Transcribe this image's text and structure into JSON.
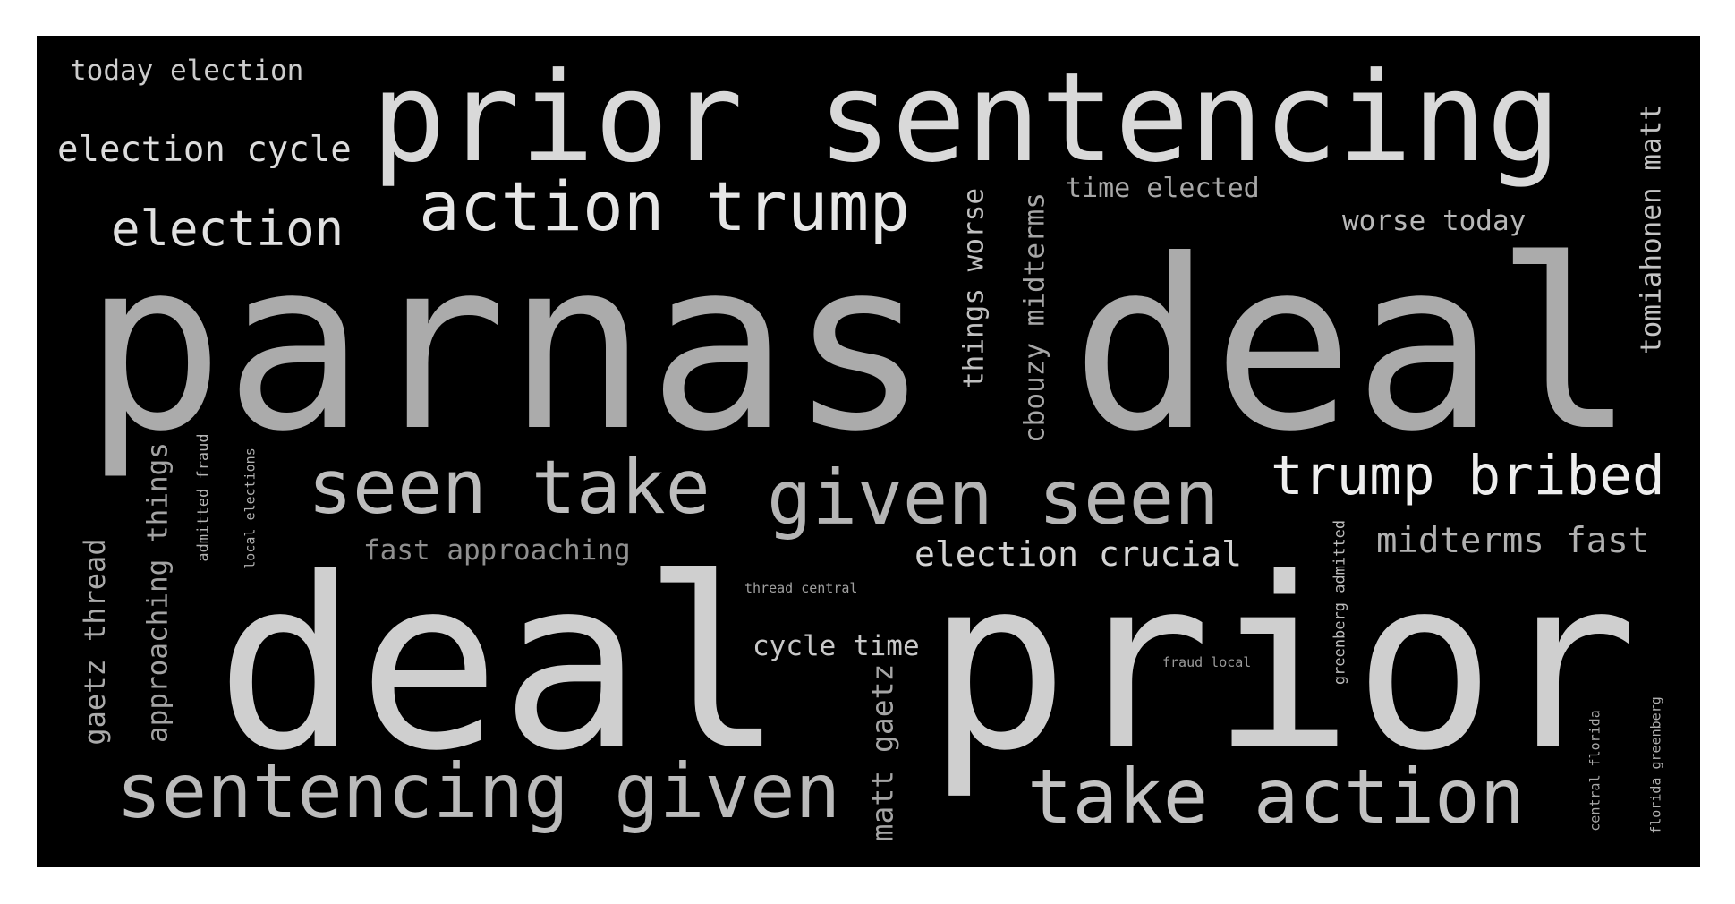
{
  "wordcloud": {
    "background": "#000000",
    "words": [
      {
        "text": "parnas deal",
        "color": "#ababab"
      },
      {
        "text": "deal prior",
        "color": "#cfcfcf"
      },
      {
        "text": "prior sentencing",
        "color": "#d9d9d9"
      },
      {
        "text": "action trump",
        "color": "#e6e6e6"
      },
      {
        "text": "seen take",
        "color": "#bdbdbd"
      },
      {
        "text": "given seen",
        "color": "#b5b5b5"
      },
      {
        "text": "trump bribed",
        "color": "#eeeeee"
      },
      {
        "text": "sentencing given",
        "color": "#bbbbbb"
      },
      {
        "text": "take action",
        "color": "#c2c2c2"
      },
      {
        "text": "election",
        "color": "#e0e0e0"
      },
      {
        "text": "election cycle",
        "color": "#dcdcdc"
      },
      {
        "text": "today election",
        "color": "#cccccc"
      },
      {
        "text": "fast approaching",
        "color": "#8f8f8f"
      },
      {
        "text": "election crucial",
        "color": "#d4d4d4"
      },
      {
        "text": "midterms fast",
        "color": "#b0b0b0"
      },
      {
        "text": "cycle time",
        "color": "#c8c8c8"
      },
      {
        "text": "time elected",
        "color": "#a8a8a8"
      },
      {
        "text": "worse today",
        "color": "#b8b8b8"
      },
      {
        "text": "thread central",
        "color": "#a0a0a0"
      },
      {
        "text": "fraud local",
        "color": "#9a9a9a"
      },
      {
        "text": "things worse",
        "color": "#c0c0c0"
      },
      {
        "text": "cbouzy midterms",
        "color": "#a6a6a6"
      },
      {
        "text": "tomiahonen matt",
        "color": "#c4c4c4"
      },
      {
        "text": "gaetz thread",
        "color": "#aaaaaa"
      },
      {
        "text": "approaching things",
        "color": "#a3a3a3"
      },
      {
        "text": "admitted fraud",
        "color": "#b3b3b3"
      },
      {
        "text": "local elections",
        "color": "#b0b0b0"
      },
      {
        "text": "matt gaetz",
        "color": "#a5a5a5"
      },
      {
        "text": "greenberg admitted",
        "color": "#bbbbbb"
      },
      {
        "text": "central florida",
        "color": "#a8a8a8"
      },
      {
        "text": "florida greenberg",
        "color": "#b0b0b0"
      }
    ]
  }
}
